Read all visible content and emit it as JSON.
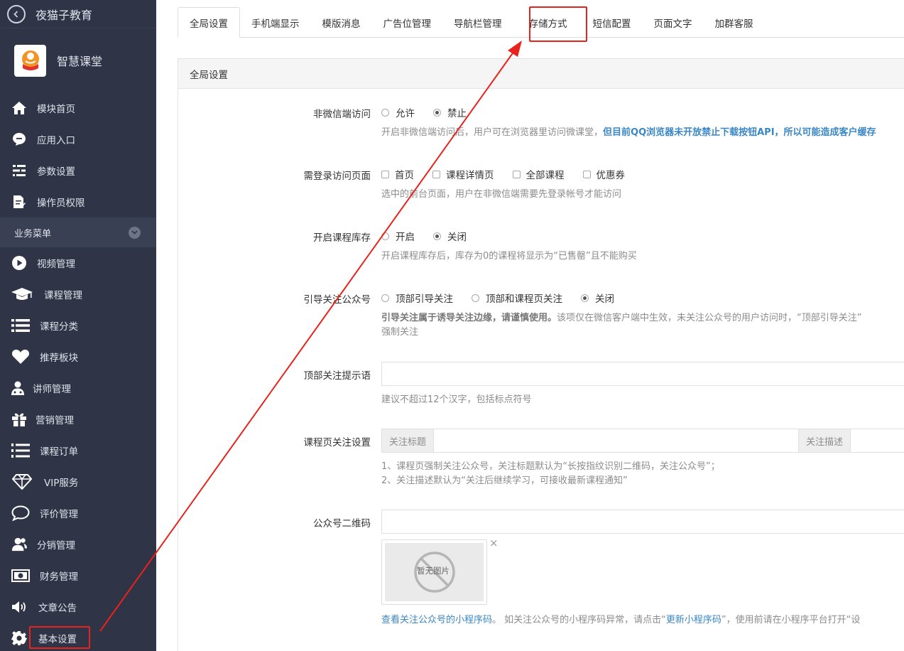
{
  "topbar": {
    "title": "夜猫子教育"
  },
  "brand": {
    "name": "智慧课堂"
  },
  "sidebar": {
    "items_top": [
      {
        "label": "模块首页",
        "icon": "home-icon"
      },
      {
        "label": "应用入口",
        "icon": "chat-bubble-icon"
      },
      {
        "label": "参数设置",
        "icon": "settings-list-icon"
      },
      {
        "label": "操作员权限",
        "icon": "edit-document-icon"
      }
    ],
    "group_label": "业务菜单",
    "items": [
      {
        "label": "视频管理",
        "icon": "play-icon"
      },
      {
        "label": "课程管理",
        "icon": "graduation-cap-icon"
      },
      {
        "label": "课程分类",
        "icon": "list-icon"
      },
      {
        "label": "推荐板块",
        "icon": "heart-icon"
      },
      {
        "label": "讲师管理",
        "icon": "teacher-icon"
      },
      {
        "label": "营销管理",
        "icon": "gift-icon"
      },
      {
        "label": "课程订单",
        "icon": "ordered-list-icon"
      },
      {
        "label": "VIP服务",
        "icon": "diamond-icon"
      },
      {
        "label": "评价管理",
        "icon": "comment-icon"
      },
      {
        "label": "分销管理",
        "icon": "users-icon"
      },
      {
        "label": "财务管理",
        "icon": "money-icon"
      },
      {
        "label": "文章公告",
        "icon": "speaker-icon"
      },
      {
        "label": "基本设置",
        "icon": "gear-icon"
      }
    ]
  },
  "tabs": [
    "全局设置",
    "手机端显示",
    "模版消息",
    "广告位管理",
    "导航栏管理",
    "存储方式",
    "短信配置",
    "页面文字",
    "加群客服"
  ],
  "active_tab": "全局设置",
  "highlighted_tab": "存储方式",
  "panel": {
    "title": "全局设置",
    "nonwechat": {
      "label": "非微信端访问",
      "options": [
        "允许",
        "禁止"
      ],
      "selected": "禁止",
      "help_plain": "开启非微信端访问后，用户可在浏览器里访问微课堂，",
      "help_bold": "但目前QQ浏览器未开放禁止下载按钮API，所以可能造成客户缓存"
    },
    "login_pages": {
      "label": "需登录访问页面",
      "options": [
        "首页",
        "课程详情页",
        "全部课程",
        "优惠券"
      ],
      "help": "选中的前台页面，用户在非微信端需要先登录帐号才能访问"
    },
    "stock": {
      "label": "开启课程库存",
      "options": [
        "开启",
        "关闭"
      ],
      "selected": "关闭",
      "help": "开启课程库存后，库存为0的课程将显示为“已售罄”且不能购买"
    },
    "follow": {
      "label": "引导关注公众号",
      "options": [
        "顶部引导关注",
        "顶部和课程页关注",
        "关闭"
      ],
      "selected": "关闭",
      "help_bold": "引导关注属于诱导关注边缘，请谨慎使用。",
      "help_plain": "该项仅在微信客户端中生效，未关注公众号的用户访问时，“顶部引导关注”",
      "help_line2": "强制关注"
    },
    "top_tip": {
      "label": "顶部关注提示语",
      "value": "",
      "help": "建议不超过12个汉字，包括标点符号"
    },
    "course_follow": {
      "label": "课程页关注设置",
      "addon_title": "关注标题",
      "addon_desc": "关注描述",
      "help_line1": "1、课程页强制关注公众号，关注标题默认为“长按指纹识别二维码，关注公众号”；",
      "help_line2": "2、关注描述默认为“关注后继续学习，可接收最新课程通知”"
    },
    "qrcode": {
      "label": "公众号二维码",
      "value": "",
      "no_image": "暂无图片",
      "close": "×",
      "link1": "查看关注公众号的小程序码",
      "text1": "。 如关注公众号的小程序码异常，请点击“",
      "link2": "更新小程序码",
      "text2": "”，使用前请在小程序平台打开“设"
    }
  },
  "colors": {
    "sidebar_bg": "#2f3446",
    "highlight": "#e8221c",
    "link": "#3a87c5"
  }
}
